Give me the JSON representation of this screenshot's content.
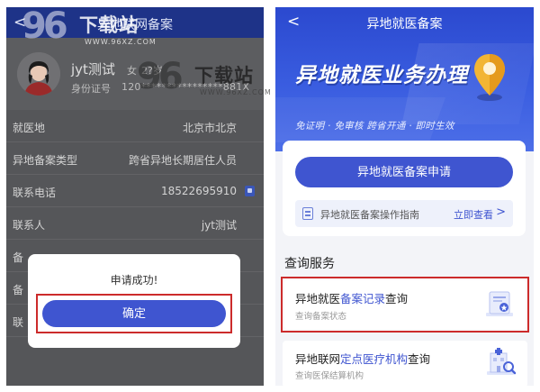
{
  "left": {
    "header_title": "异地联网备案",
    "back": "<",
    "profile": {
      "name": "jyt测试",
      "gender": "女",
      "age": "2?岁",
      "id_label": "身份证号",
      "id_value": "120****************881X"
    },
    "fields": [
      {
        "label": "就医地",
        "value": "北京市北京"
      },
      {
        "label": "异地备案类型",
        "value": "跨省异地长期居住人员"
      },
      {
        "label": "联系电话",
        "value": "18522695910"
      },
      {
        "label": "联系人",
        "value": "jyt测试"
      },
      {
        "label": "备",
        "value": ""
      },
      {
        "label": "备",
        "value": ""
      },
      {
        "label": "联",
        "value": ""
      }
    ],
    "dialog": {
      "message": "申请成功!",
      "confirm_label": "确定"
    }
  },
  "right": {
    "back": "<",
    "header_title": "异地就医备案",
    "banner": {
      "headline": "异地就医业务办理",
      "slogan": "免证明 · 免审核  跨省开通 · 即时生效"
    },
    "apply_label": "异地就医备案申请",
    "guide": {
      "text": "异地就医备案操作指南",
      "link": "立即查看",
      "chevron": ">"
    },
    "section_title": "查询服务",
    "services": [
      {
        "title_pre": "异地就医",
        "title_hl": "备案记录",
        "title_post": "查询",
        "subtitle": "查询备案状态"
      },
      {
        "title_pre": "异地联网",
        "title_hl": "定点医疗机构",
        "title_post": "查询",
        "subtitle": "查询医保结算机构"
      }
    ]
  },
  "watermark": {
    "number": "96",
    "text": "下载站",
    "url": "WWW.96XZ.COM"
  },
  "colors": {
    "accent": "#3f55d0",
    "highlight_border": "#cc2b2b",
    "dim_overlay": "#555659",
    "header_blue": "#1e3388"
  }
}
